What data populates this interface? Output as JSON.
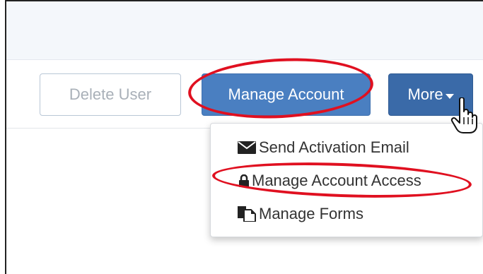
{
  "toolbar": {
    "delete_label": "Delete User",
    "manage_account_label": "Manage Account",
    "more_label": "More"
  },
  "more_menu": {
    "items": [
      {
        "label": "Send Activation Email",
        "icon": "envelope-icon"
      },
      {
        "label": "Manage Account Access",
        "icon": "lock-icon"
      },
      {
        "label": "Manage Forms",
        "icon": "forms-icon"
      }
    ]
  },
  "colors": {
    "primary_button": "#4a7fc1",
    "more_button": "#3a6aa8",
    "highlight": "#e01020"
  }
}
